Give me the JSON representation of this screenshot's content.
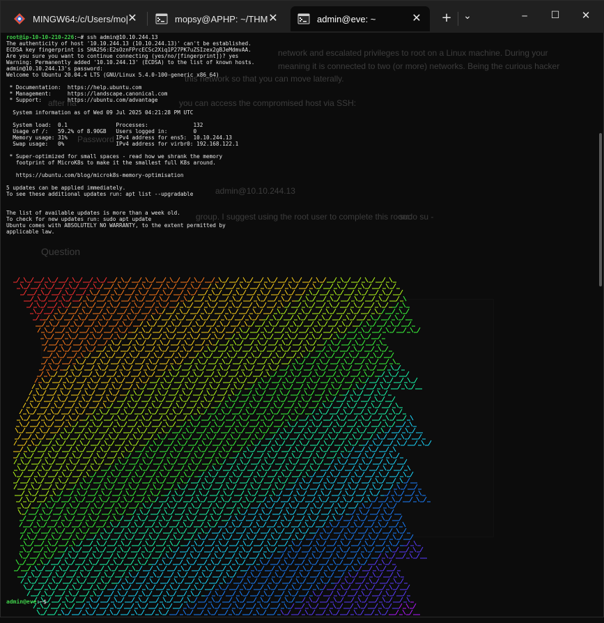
{
  "tabs": [
    {
      "label": "MINGW64:/c/Users/mo|",
      "icon": "git-bash-icon",
      "active": false
    },
    {
      "label": "mopsy@APHP: ~/THM",
      "icon": "linux-terminal-icon",
      "active": false
    },
    {
      "label": "admin@eve: ~",
      "icon": "linux-terminal-icon",
      "active": true
    }
  ],
  "toolbar": {
    "new_tab": "+",
    "dropdown": "⌄"
  },
  "window_controls": {
    "minimize": "─",
    "maximize": "☐",
    "close": "✕"
  },
  "terminal": {
    "first_prompt": "root@ip-10-10-210-226",
    "first_prompt_suffix": ":~# ssh admin@10.10.244.13",
    "lines": [
      "The authenticity of host '10.10.244.13 (10.10.244.13)' can't be established.",
      "ECDSA key fingerprint is SHA256:E2sOznFPrcECSc2Xiq1P27PK7uZSIzex2gBJeMdmvAA.",
      "Are you sure you want to continue connecting (yes/no/[fingerprint])? yes",
      "Warning: Permanently added '10.10.244.13' (ECDSA) to the list of known hosts.",
      "admin@10.10.244.13's password:",
      "Welcome to Ubuntu 20.04.4 LTS (GNU/Linux 5.4.0-100-generic x86_64)",
      "",
      " * Documentation:  https://help.ubuntu.com",
      " * Management:     https://landscape.canonical.com",
      " * Support:        https://ubuntu.com/advantage",
      "",
      "  System information as of Wed 09 Jul 2025 04:21:28 PM UTC",
      "",
      "  System load:  0.1               Processes:              132",
      "  Usage of /:   59.2% of 8.90GB   Users logged in:        0",
      "  Memory usage: 31%               IPv4 address for ens5:  10.10.244.13",
      "  Swap usage:   0%                IPv4 address for virbr0: 192.168.122.1",
      "",
      " * Super-optimized for small spaces - read how we shrank the memory",
      "   footprint of MicroK8s to make it the smallest full K8s around.",
      "",
      "   https://ubuntu.com/blog/microk8s-memory-optimisation",
      "",
      "5 updates can be applied immediately.",
      "To see these additional updates run: apt list --upgradable",
      "",
      "",
      "The list of available updates is more than a week old.",
      "To check for new updates run: sudo apt update",
      "Ubuntu comes with ABSOLUTELY NO WARRANTY, to the extent permitted by",
      "applicable law."
    ],
    "last_prompt": "admin@eve",
    "last_prompt_suffix": ":~$"
  },
  "background_ghost": {
    "line1": "network and escalated privileges to root on a Linux machine. During your",
    "line2": "meaning it is connected to two (or more) networks. Being the curious hacker",
    "line3": "this network so that you can move laterally.",
    "line4": "after ha",
    "line4b": "you can access the compromised host via SSH:",
    "password": "Password",
    "ssh_cmd": "admin@10.10.244.13",
    "suggest": "group. I suggest using the root user to complete this room:",
    "suggest_cmd": "sudo su -",
    "question": "Question"
  }
}
